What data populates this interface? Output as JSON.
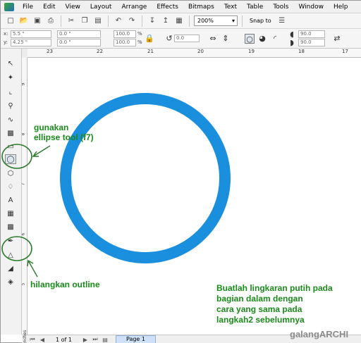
{
  "menu": [
    "File",
    "Edit",
    "View",
    "Layout",
    "Arrange",
    "Effects",
    "Bitmaps",
    "Text",
    "Table",
    "Tools",
    "Window",
    "Help"
  ],
  "toolbar": {
    "zoom": "200%",
    "snap": "Snap to"
  },
  "propbar": {
    "x": "5.5 \"",
    "y": "4.25 \"",
    "w": "0.0 \"",
    "h": "0.0 \"",
    "scale_w": "100.0",
    "scale_h": "100.0",
    "pct": "%",
    "rotation": "0.0",
    "start_angle": "90.0",
    "end_angle": "90.0",
    "x_label": "x:",
    "y_label": "y:"
  },
  "ruler": {
    "top_ticks": [
      "23",
      "22",
      "21",
      "20",
      "19",
      "18",
      "17"
    ],
    "left_ticks": [
      "9",
      "8",
      "7",
      "6",
      "5"
    ]
  },
  "status": {
    "page_of": "1 of 1",
    "page_tab": "Page 1",
    "units": "inches"
  },
  "annotations": {
    "ellipse_tool": "gunakan\nellipse tool (f7)",
    "outline": "hilangkan outline",
    "instruction": "Buatlah lingkaran putih pada\nbagian dalam dengan\ncara yang sama pada\nlangkah2 sebelumnya",
    "watermark": "galangARCHI"
  },
  "colors": {
    "circle_outline": "#1a8fde",
    "annotation": "#1a8a1a"
  },
  "icons": [
    "new-icon",
    "open-icon",
    "save-icon",
    "print-icon",
    "cut-icon",
    "copy-icon",
    "paste-icon",
    "undo-icon",
    "redo-icon",
    "import-icon",
    "export-icon",
    "app-launcher-icon",
    "pick-tool-icon",
    "shape-tool-icon",
    "crop-tool-icon",
    "zoom-tool-icon",
    "freehand-tool-icon",
    "smart-fill-icon",
    "rectangle-tool-icon",
    "ellipse-tool-icon",
    "polygon-tool-icon",
    "basic-shapes-icon",
    "text-tool-icon",
    "table-tool-icon",
    "interactive-blend-icon",
    "eyedropper-icon",
    "outline-pen-icon",
    "fill-tool-icon",
    "interactive-fill-icon"
  ]
}
